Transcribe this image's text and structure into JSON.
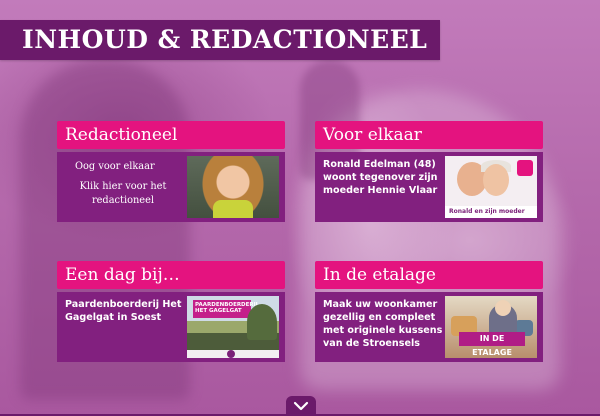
{
  "header": {
    "title": "INHOUD & REDACTIONEEL"
  },
  "cards": [
    {
      "title": "Redactioneel",
      "line1": "Oog voor elkaar",
      "line2": "Klik hier voor het redactioneel",
      "image_alt": "portrait-woman-yellow-scarf"
    },
    {
      "title": "Voor elkaar",
      "text": "Ronald Edelman (48) woont tegenover zijn moeder Hennie Vlaar",
      "image_caption": "Ronald en zijn moeder"
    },
    {
      "title": "Een dag bij…",
      "text": "Paardenboerderij Het Gagelgat in Soest",
      "image_band": "PAARDENBOERDERIJ HET GAGELGAT"
    },
    {
      "title": "In de etalage",
      "text": "Maak uw woonkamer gezellig en compleet met originele kussens van de Stroensels",
      "image_band": "IN DE ETALAGE"
    }
  ],
  "nav": {
    "scroll_icon": "chevron-down-icon"
  },
  "colors": {
    "header": "#6b1a6a",
    "card_title": "#e4137f",
    "card_body": "#82207f"
  }
}
